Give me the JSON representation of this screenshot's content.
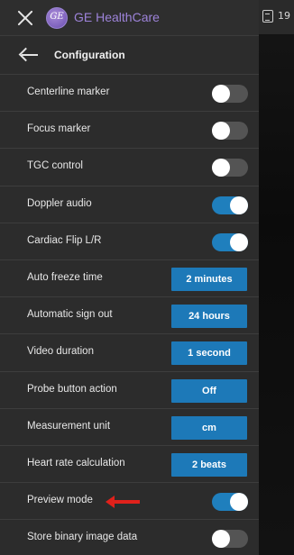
{
  "header": {
    "close_icon": "close-icon",
    "logo_text": "GE",
    "brand": "GE HealthCare",
    "brand_color": "#9d83d9"
  },
  "status": {
    "icon": "clipboard-icon",
    "value": "19"
  },
  "subheader": {
    "back_icon": "arrow-left-icon",
    "title": "Configuration"
  },
  "colors": {
    "accent": "#1d79b8",
    "toggle_on": "#1f7fbd",
    "toggle_off": "#545454",
    "annotation_arrow": "#e0211b"
  },
  "settings": [
    {
      "label": "Centerline marker",
      "type": "toggle",
      "on": false
    },
    {
      "label": "Focus marker",
      "type": "toggle",
      "on": false
    },
    {
      "label": "TGC control",
      "type": "toggle",
      "on": false
    },
    {
      "label": "Doppler audio",
      "type": "toggle",
      "on": true
    },
    {
      "label": "Cardiac Flip L/R",
      "type": "toggle",
      "on": true
    },
    {
      "label": "Auto freeze time",
      "type": "value",
      "value": "2 minutes"
    },
    {
      "label": "Automatic sign out",
      "type": "value",
      "value": "24 hours"
    },
    {
      "label": "Video duration",
      "type": "value",
      "value": "1 second"
    },
    {
      "label": "Probe button action",
      "type": "value",
      "value": "Off"
    },
    {
      "label": "Measurement unit",
      "type": "value",
      "value": "cm"
    },
    {
      "label": "Heart rate calculation",
      "type": "value",
      "value": "2 beats"
    },
    {
      "label": "Preview mode",
      "type": "toggle",
      "on": true,
      "annotation": "red-arrow-icon"
    },
    {
      "label": "Store binary image data",
      "type": "toggle",
      "on": false
    }
  ]
}
